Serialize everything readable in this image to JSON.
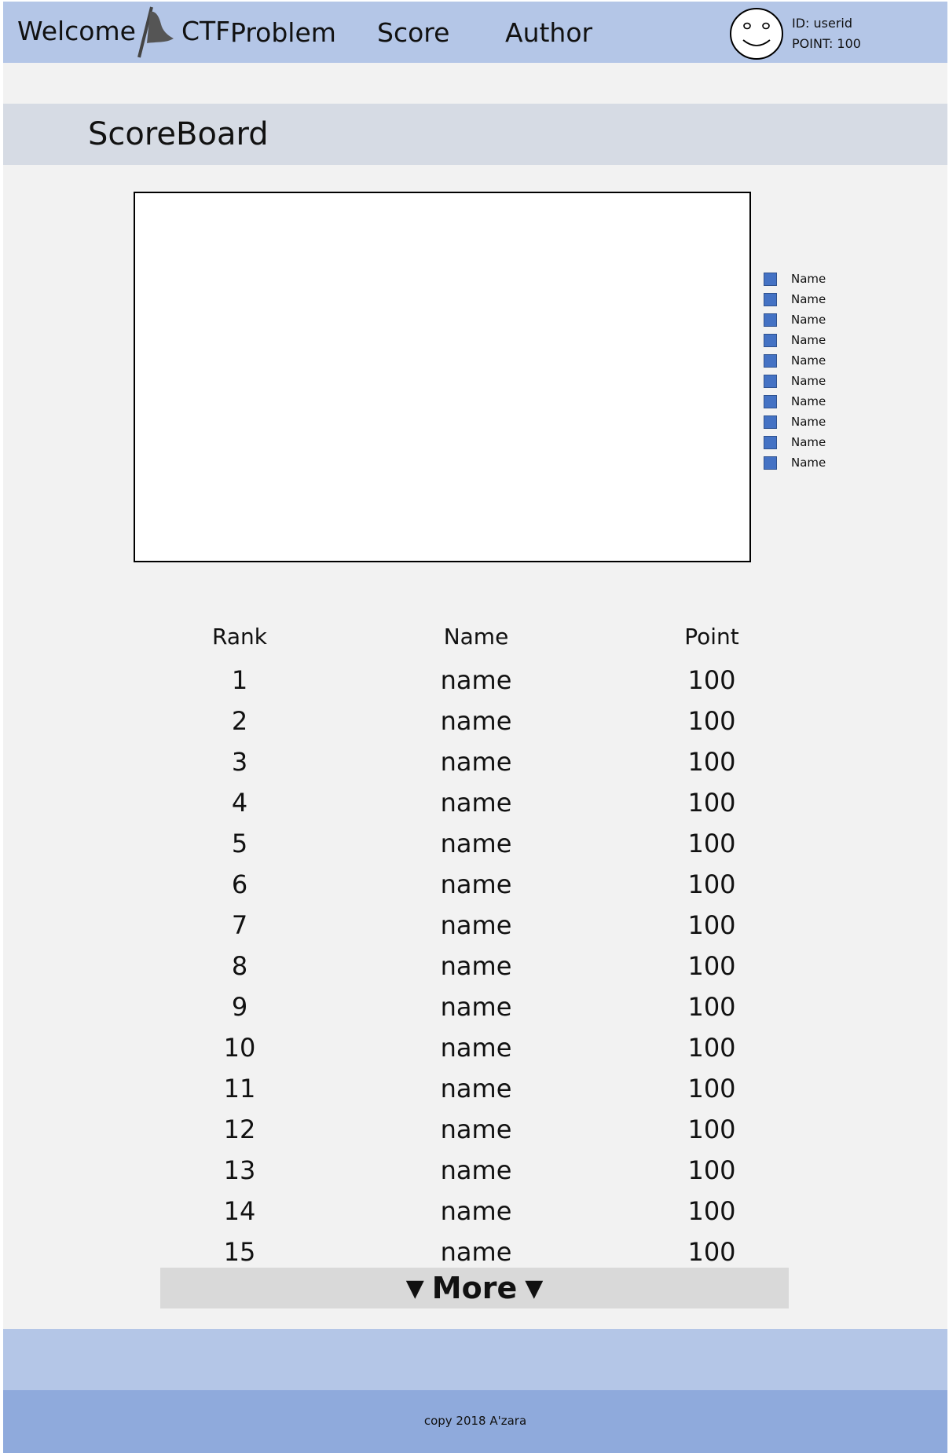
{
  "header": {
    "brand_welcome": "Welcome",
    "brand_ctf": "CTF",
    "nav": [
      "Problem",
      "Score",
      "Author"
    ],
    "user_id": "ID: userid",
    "user_point": "POINT: 100",
    "color": "#b4c6e7"
  },
  "title": "ScoreBoard",
  "chart": {
    "legend": [
      "Name",
      "Name",
      "Name",
      "Name",
      "Name",
      "Name",
      "Name",
      "Name",
      "Name",
      "Name"
    ],
    "legend_color": "#4472c4"
  },
  "table": {
    "headers": [
      "Rank",
      "Name",
      "Point"
    ],
    "rows": [
      [
        "1",
        "name",
        "100"
      ],
      [
        "2",
        "name",
        "100"
      ],
      [
        "3",
        "name",
        "100"
      ],
      [
        "4",
        "name",
        "100"
      ],
      [
        "5",
        "name",
        "100"
      ],
      [
        "6",
        "name",
        "100"
      ],
      [
        "7",
        "name",
        "100"
      ],
      [
        "8",
        "name",
        "100"
      ],
      [
        "9",
        "name",
        "100"
      ],
      [
        "10",
        "name",
        "100"
      ],
      [
        "11",
        "name",
        "100"
      ],
      [
        "12",
        "name",
        "100"
      ],
      [
        "13",
        "name",
        "100"
      ],
      [
        "14",
        "name",
        "100"
      ],
      [
        "15",
        "name",
        "100"
      ]
    ]
  },
  "more_button": {
    "label": "More",
    "arrow_left": "▼",
    "arrow_right": "▼"
  },
  "footer": {
    "copyright": "copy 2018 A'zara"
  },
  "icons": {
    "brand": "flag-icon",
    "avatar": "smiley-face-icon"
  }
}
